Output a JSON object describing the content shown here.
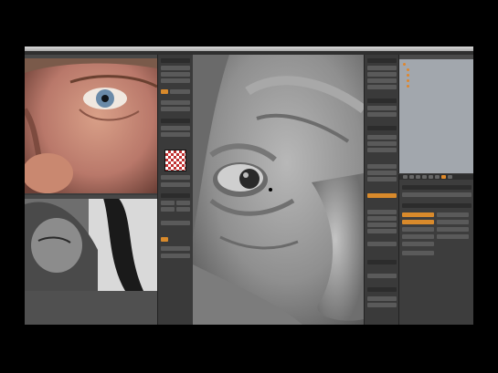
{
  "colors": {
    "accent": "#d98a2b",
    "ui_bg": "#3c3c3c",
    "panel_dark": "#2c2c2c",
    "outliner_bg": "#a2a7ad",
    "sculpt_clay": "#8a8a8a"
  },
  "icons": {
    "texture_preview": "checker-texture-icon",
    "object_dot": "mesh-object-icon",
    "visibility": "eye-icon"
  },
  "window": {
    "title": ""
  },
  "viewport": {
    "label_top": "",
    "label_bottom": ""
  },
  "outliner": {
    "rows": [
      "",
      "",
      "",
      "",
      ""
    ]
  }
}
